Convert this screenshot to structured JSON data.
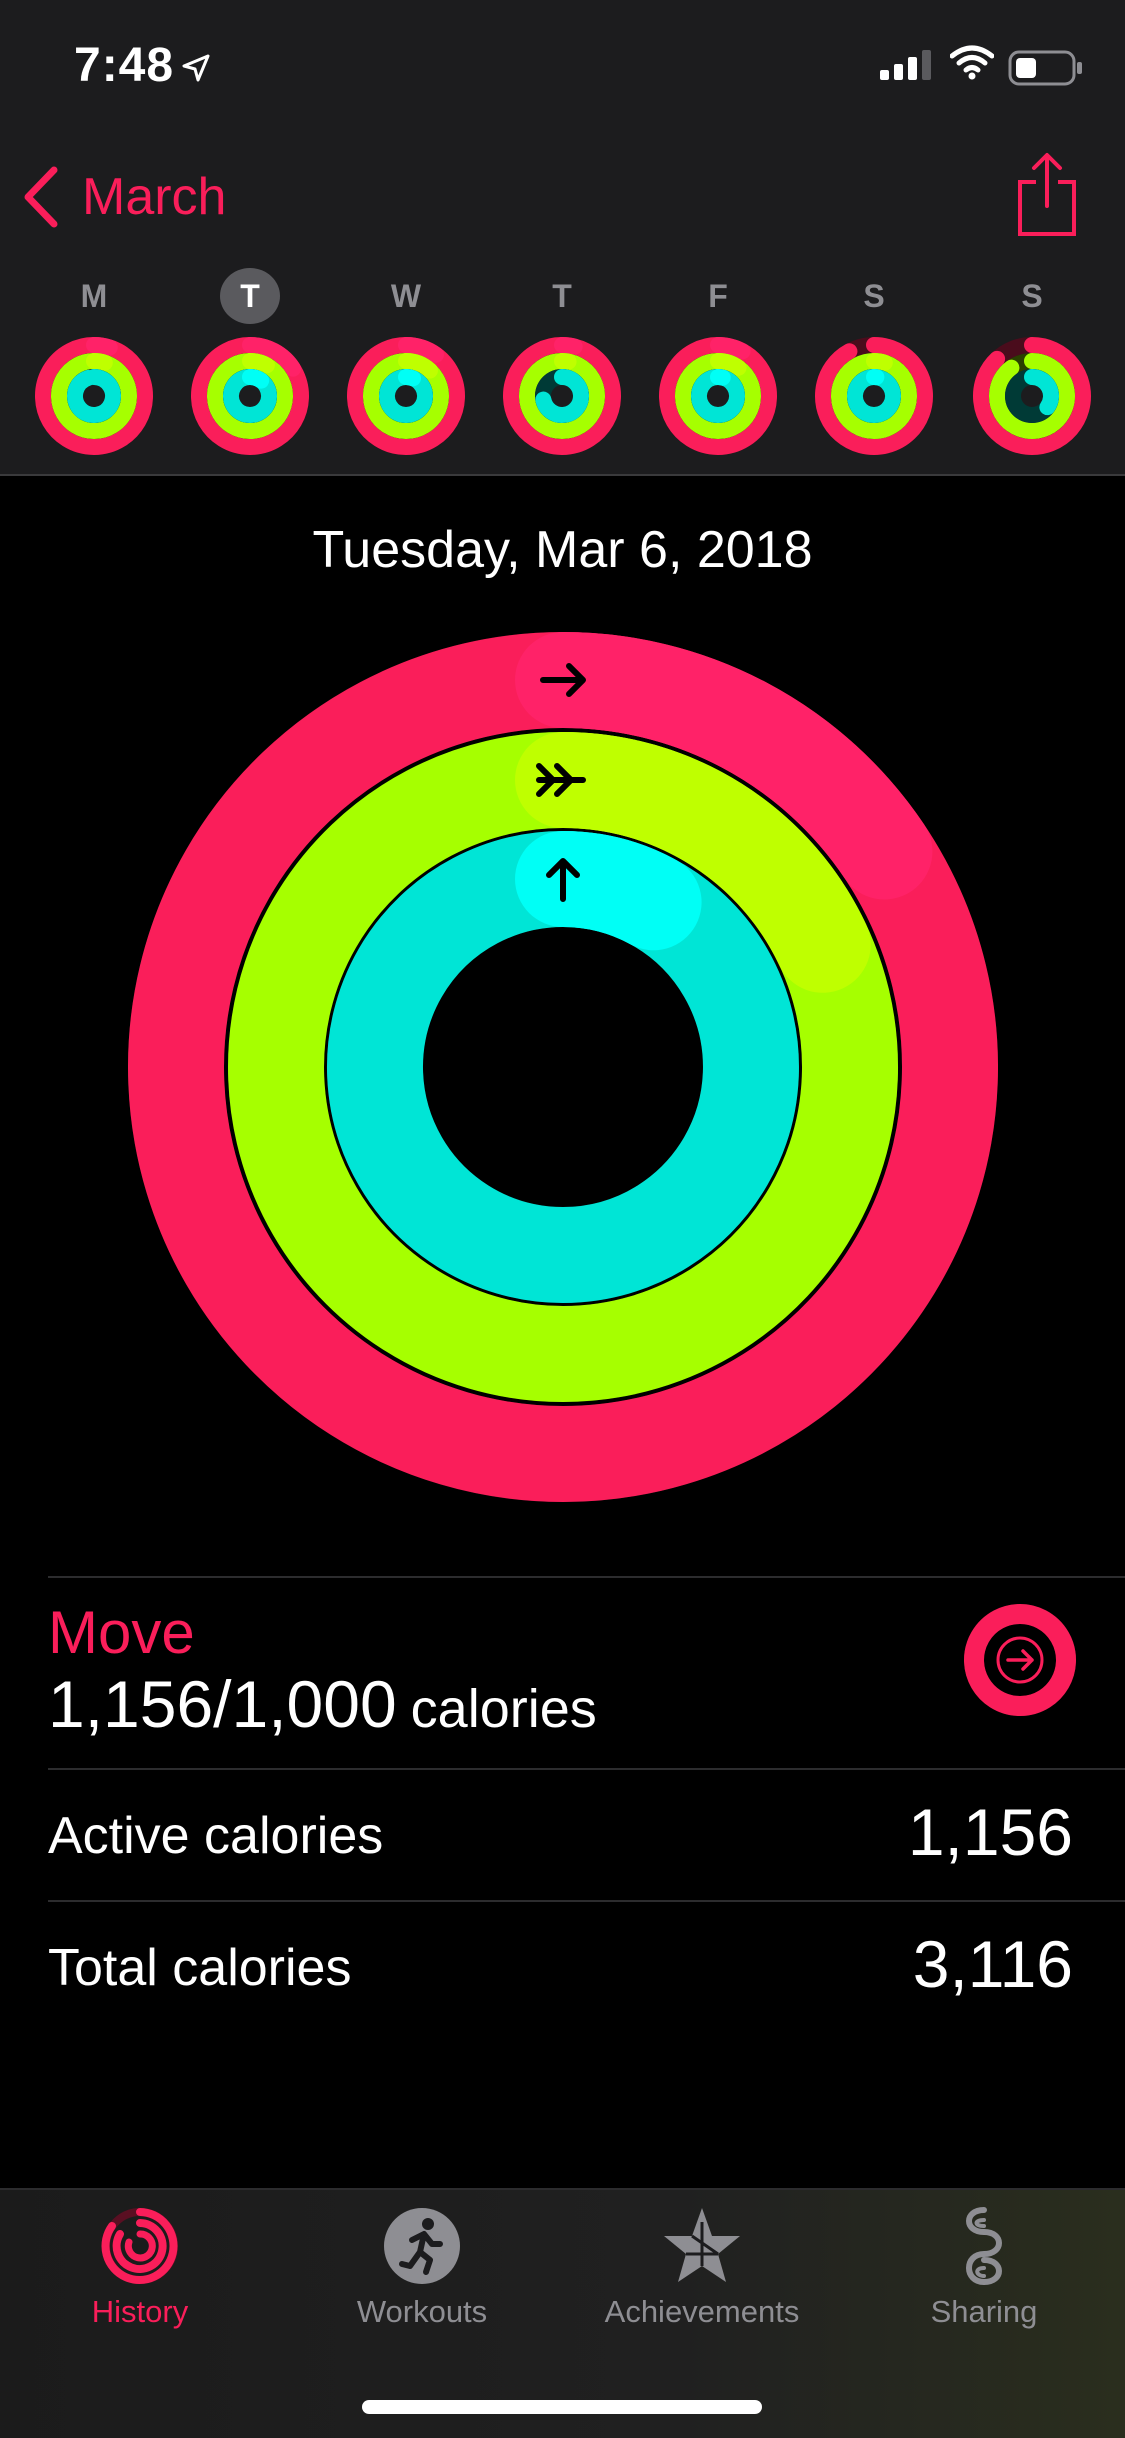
{
  "status_bar": {
    "time": "7:48"
  },
  "nav": {
    "back_label": "March"
  },
  "week": {
    "days": [
      {
        "label": "M",
        "selected": false
      },
      {
        "label": "T",
        "selected": true
      },
      {
        "label": "W",
        "selected": false
      },
      {
        "label": "T",
        "selected": false
      },
      {
        "label": "F",
        "selected": false
      },
      {
        "label": "S",
        "selected": false
      },
      {
        "label": "S",
        "selected": false
      }
    ],
    "move_progress": [
      1.05,
      1.16,
      1.1,
      1.04,
      1.08,
      0.92,
      0.88
    ],
    "exercise_progress": [
      1.05,
      1.08,
      1.12,
      1.03,
      1.1,
      1.05,
      0.9
    ],
    "stand_progress": [
      0.95,
      1.1,
      1.06,
      0.72,
      1.04,
      1.02,
      0.35
    ]
  },
  "selected_date": "Tuesday, Mar 6, 2018",
  "rings": {
    "move": 1.156,
    "exercise": 1.18,
    "stand": 1.08,
    "colors": {
      "move": "#fa1e5a",
      "exercise": "#a6ff00",
      "stand": "#00e5d6"
    }
  },
  "move": {
    "title": "Move",
    "value": "1,156/1,000",
    "unit": "calories"
  },
  "stats": [
    {
      "label": "Active calories",
      "value": "1,156"
    },
    {
      "label": "Total calories",
      "value": "3,116"
    }
  ],
  "tabs": [
    {
      "label": "History",
      "icon": "history-rings-icon",
      "active": true
    },
    {
      "label": "Workouts",
      "icon": "running-figure-icon",
      "active": false
    },
    {
      "label": "Achievements",
      "icon": "star-badge-icon",
      "active": false
    },
    {
      "label": "Sharing",
      "icon": "sharing-icon",
      "active": false
    }
  ]
}
